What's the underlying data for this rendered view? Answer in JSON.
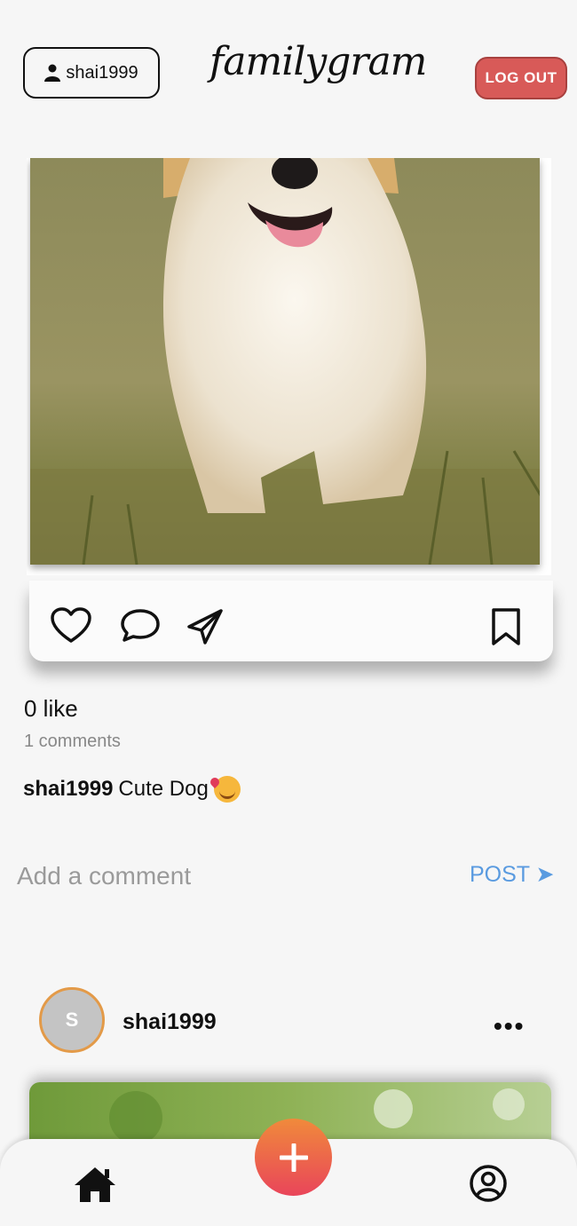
{
  "header": {
    "username": "shai1999",
    "brand": "familygram",
    "logout_label": "LOG OUT"
  },
  "post1": {
    "likes": "0 like",
    "comments": "1 comments",
    "caption_user": "shai1999",
    "caption_text": "Cute Dog",
    "comment_placeholder": "Add a comment",
    "post_label": "POST ➤"
  },
  "post2": {
    "avatar_initial": "S",
    "username": "shai1999",
    "more_label": "•••"
  },
  "colors": {
    "logout": "#d85a58",
    "post_link": "#5a9be0",
    "avatar_ring": "#e39a48",
    "add_gradient_top": "#f08a3b",
    "add_gradient_bottom": "#e9455a"
  },
  "icons": [
    "user-icon",
    "heart-icon",
    "comment-icon",
    "send-icon",
    "bookmark-icon",
    "home-icon",
    "plus-icon",
    "profile-icon",
    "more-icon"
  ]
}
